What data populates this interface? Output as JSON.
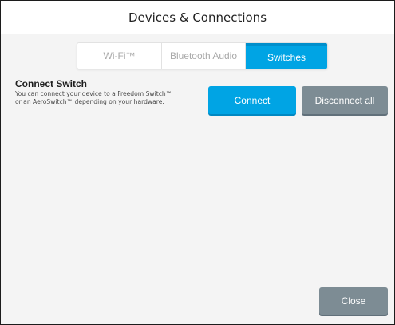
{
  "dialog": {
    "title": "Devices & Connections"
  },
  "tabs": [
    {
      "label": "Wi-Fi™",
      "active": false
    },
    {
      "label": "Bluetooth Audio",
      "active": false
    },
    {
      "label": "Switches",
      "active": true
    }
  ],
  "connect_section": {
    "title": "Connect Switch",
    "description": "You can connect your device to a Freedom Switch™ or an AeroSwitch™ depending on your hardware."
  },
  "buttons": {
    "connect": "Connect",
    "disconnect_all": "Disconnect all",
    "close": "Close"
  },
  "colors": {
    "accent": "#00a4e4",
    "secondary_button": "#7d8c94",
    "panel_background": "#f4f4f4"
  }
}
